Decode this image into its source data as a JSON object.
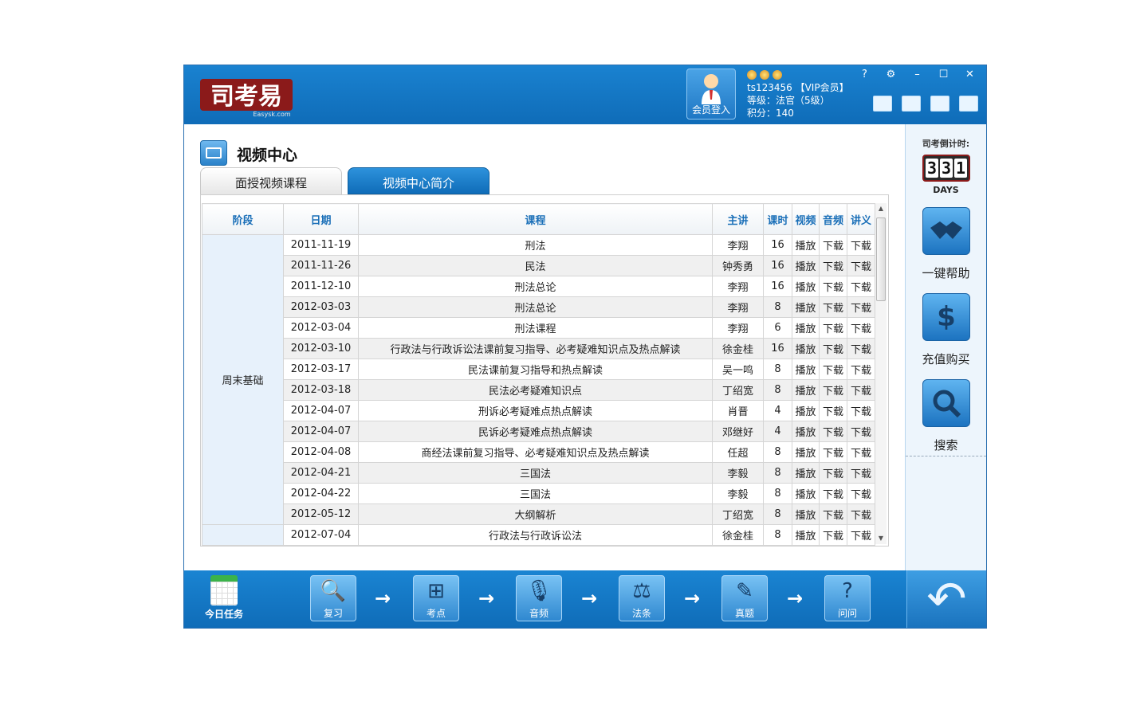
{
  "app": {
    "logo_text": "司考易",
    "logo_sub": "Easysk.com"
  },
  "header": {
    "login_label": "会员登入",
    "username": "ts123456 【VIP会员】",
    "level": "等级：法官（5级）",
    "points": "积分：140",
    "window_controls": [
      "?",
      "⚙",
      "–",
      "☐",
      "✕"
    ]
  },
  "section": {
    "title": "视频中心",
    "tabs": [
      {
        "label": "面授视频课程",
        "active": true
      },
      {
        "label": "视频中心简介",
        "active": false
      }
    ]
  },
  "table": {
    "headers": [
      "阶段",
      "日期",
      "课程",
      "主讲",
      "课时",
      "视频",
      "音频",
      "讲义"
    ],
    "stage_label": "周末基础",
    "rows": [
      {
        "date": "2011-11-19",
        "course": "刑法",
        "teacher": "李翔",
        "hours": "16",
        "video": "播放",
        "audio": "下载",
        "notes": "下载"
      },
      {
        "date": "2011-11-26",
        "course": "民法",
        "teacher": "钟秀勇",
        "hours": "16",
        "video": "播放",
        "audio": "下载",
        "notes": "下载"
      },
      {
        "date": "2011-12-10",
        "course": "刑法总论",
        "teacher": "李翔",
        "hours": "16",
        "video": "播放",
        "audio": "下载",
        "notes": "下载"
      },
      {
        "date": "2012-03-03",
        "course": "刑法总论",
        "teacher": "李翔",
        "hours": "8",
        "video": "播放",
        "audio": "下载",
        "notes": "下载"
      },
      {
        "date": "2012-03-04",
        "course": "刑法课程",
        "teacher": "李翔",
        "hours": "6",
        "video": "播放",
        "audio": "下载",
        "notes": "下载"
      },
      {
        "date": "2012-03-10",
        "course": "行政法与行政诉讼法课前复习指导、必考疑难知识点及热点解读",
        "teacher": "徐金桂",
        "hours": "16",
        "video": "播放",
        "audio": "下载",
        "notes": "下载"
      },
      {
        "date": "2012-03-17",
        "course": "民法课前复习指导和热点解读",
        "teacher": "吴一鸣",
        "hours": "8",
        "video": "播放",
        "audio": "下载",
        "notes": "下载"
      },
      {
        "date": "2012-03-18",
        "course": "民法必考疑难知识点",
        "teacher": "丁绍宽",
        "hours": "8",
        "video": "播放",
        "audio": "下载",
        "notes": "下载"
      },
      {
        "date": "2012-04-07",
        "course": "刑诉必考疑难点热点解读",
        "teacher": "肖晋",
        "hours": "4",
        "video": "播放",
        "audio": "下载",
        "notes": "下载"
      },
      {
        "date": "2012-04-07",
        "course": "民诉必考疑难点热点解读",
        "teacher": "邓继好",
        "hours": "4",
        "video": "播放",
        "audio": "下载",
        "notes": "下载"
      },
      {
        "date": "2012-04-08",
        "course": "商经法课前复习指导、必考疑难知识点及热点解读",
        "teacher": "任超",
        "hours": "8",
        "video": "播放",
        "audio": "下载",
        "notes": "下载"
      },
      {
        "date": "2012-04-21",
        "course": "三国法",
        "teacher": "李毅",
        "hours": "8",
        "video": "播放",
        "audio": "下载",
        "notes": "下载"
      },
      {
        "date": "2012-04-22",
        "course": "三国法",
        "teacher": "李毅",
        "hours": "8",
        "video": "播放",
        "audio": "下载",
        "notes": "下载"
      },
      {
        "date": "2012-05-12",
        "course": "大纲解析",
        "teacher": "丁绍宽",
        "hours": "8",
        "video": "播放",
        "audio": "下载",
        "notes": "下载"
      },
      {
        "date": "2012-07-04",
        "course": "行政法与行政诉讼法",
        "teacher": "徐金桂",
        "hours": "8",
        "video": "播放",
        "audio": "下载",
        "notes": "下载"
      }
    ]
  },
  "sidebar": {
    "countdown_label": "司考倒计时:",
    "countdown_digits": [
      "3",
      "3",
      "1"
    ],
    "countdown_unit": "DAYS",
    "buttons": [
      {
        "label": "一键帮助",
        "icon": "handshake-icon"
      },
      {
        "label": "充值购买",
        "icon": "dollar-icon"
      },
      {
        "label": "搜索",
        "icon": "magnifier-icon"
      }
    ]
  },
  "bottom": {
    "today_label": "今日任务",
    "steps": [
      {
        "label": "复习",
        "icon": "review-icon"
      },
      {
        "label": "考点",
        "icon": "site-map-icon"
      },
      {
        "label": "音频",
        "icon": "microphone-icon"
      },
      {
        "label": "法条",
        "icon": "scales-icon"
      },
      {
        "label": "真题",
        "icon": "edit-icon"
      },
      {
        "label": "问问",
        "icon": "question-icon"
      }
    ]
  },
  "colors": {
    "brand_blue": "#0f6cb8",
    "header_text_blue": "#1a6fb8",
    "logo_red": "#8b1a1a"
  }
}
